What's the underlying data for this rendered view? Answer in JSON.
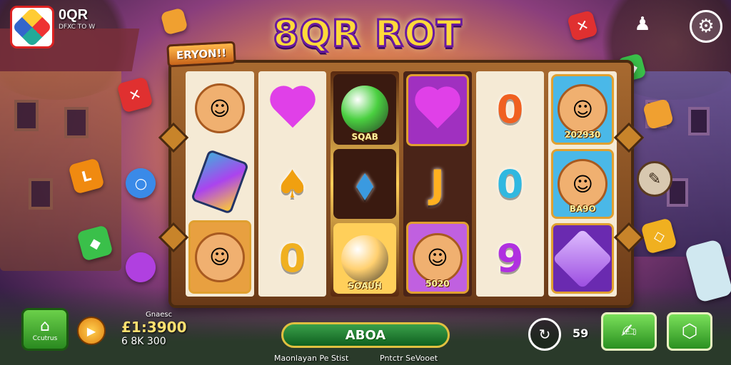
{
  "brand": {
    "name": "0QR",
    "sub": "DFXC TO W"
  },
  "title": "8QR ROT",
  "frame_tag": "ERYON!!",
  "reels": [
    [
      {
        "kind": "face",
        "glyph": "☺",
        "bg": "#f5ead5"
      },
      {
        "kind": "card",
        "bg": "#f5ead5"
      },
      {
        "kind": "face",
        "glyph": "☺",
        "bg": "#e8a040",
        "boxed": true
      }
    ],
    [
      {
        "kind": "heart",
        "bg": "#f5ead5"
      },
      {
        "kind": "text",
        "glyph": "♠",
        "color": "#f0a010",
        "bg": "#f5ead5"
      },
      {
        "kind": "text",
        "glyph": "0",
        "color": "#f0b020",
        "bg": "#f5ead5"
      }
    ],
    [
      {
        "kind": "ball",
        "color": "#4ad040",
        "bg": "#3a1a10",
        "label": "SQAB"
      },
      {
        "kind": "text",
        "glyph": "⬧",
        "color": "#3a9ae0",
        "bg": "#3a1a10"
      },
      {
        "kind": "ball",
        "color": "#ffd070",
        "bg": "#ffcf5a",
        "label": "SOAUH"
      }
    ],
    [
      {
        "kind": "heart",
        "bg": "#a030c0",
        "boxed": true
      },
      {
        "kind": "text",
        "glyph": "J",
        "color": "#ffb020",
        "bg": "#4a2418"
      },
      {
        "kind": "face",
        "glyph": "☺",
        "bg": "#c060e0",
        "boxed": true,
        "label": "5020"
      }
    ],
    [
      {
        "kind": "text",
        "glyph": "0",
        "color": "#f06020",
        "bg": "#f5ead5"
      },
      {
        "kind": "text",
        "glyph": "0",
        "color": "#30b8e0",
        "bg": "#f5ead5"
      },
      {
        "kind": "text",
        "glyph": "9",
        "color": "#b030e0",
        "bg": "#f5ead5"
      }
    ],
    [
      {
        "kind": "face",
        "glyph": "☺",
        "bg": "#4ab8e8",
        "boxed": true,
        "label": "202930"
      },
      {
        "kind": "face",
        "glyph": "☺",
        "bg": "#4ab8e8",
        "boxed": true,
        "label": "BA9O"
      },
      {
        "kind": "gem",
        "color": "#9a4ae0",
        "bg": "#6a2ab0",
        "boxed": true
      }
    ]
  ],
  "home": {
    "icon": "home-icon",
    "label": "Ccutrus"
  },
  "balance": {
    "label": "Gnaesc",
    "amount": "£1:3900",
    "sub": "6 8K 300"
  },
  "spin_label": "ABOA",
  "footer": {
    "left": "Maonlayan Pe Stist",
    "right": "Pntctr SeVooet"
  },
  "count": "59",
  "colors": {
    "accent": "#ffd93a",
    "green": "#2a9020",
    "frame": "#6a3a18"
  }
}
